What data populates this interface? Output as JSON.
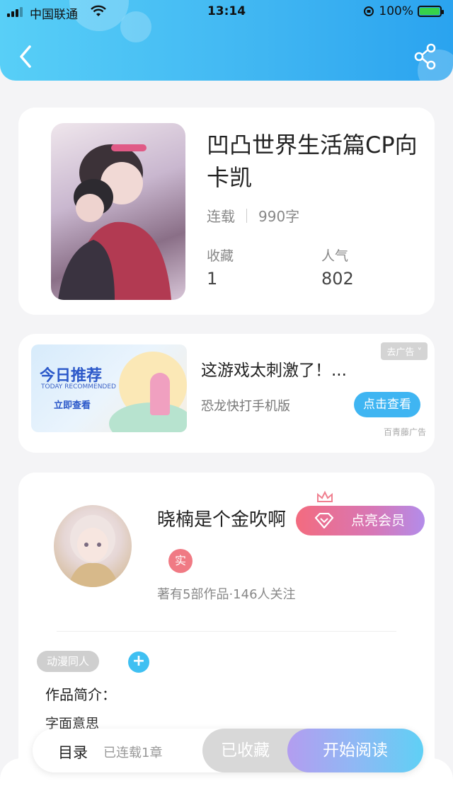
{
  "status_bar": {
    "carrier": "中国联通",
    "time": "13:14",
    "battery": "100%"
  },
  "book": {
    "title": "凹凸世界生活篇CP向卡凯",
    "status": "连载",
    "word_count": "990字",
    "stats": [
      {
        "label": "收藏",
        "value": "1"
      },
      {
        "label": "人气",
        "value": "802"
      }
    ]
  },
  "ad": {
    "tag": "去广告 ˅",
    "image_title": "今日推荐",
    "image_subtitle": "TODAY RECOMMENDED",
    "image_cta": "立即查看",
    "title": "这游戏太刺激了！...",
    "subtitle": "恐龙快打手机版",
    "button": "点击查看",
    "source": "百青藤广告"
  },
  "author": {
    "name": "晓楠是个金吹啊",
    "vip_button": "点亮会员",
    "badge": "实",
    "stats": "著有5部作品·146人关注",
    "tag": "动漫同人",
    "add_tag": "+",
    "intro_label": "作品简介：",
    "intro_text": "字面意思"
  },
  "bottom_bar": {
    "toc": "目录",
    "toc_status": "已连载1章",
    "favorite": "已收藏",
    "read": "开始阅读"
  },
  "colors": {
    "accent": "#3fb5f2",
    "header_start": "#58cff7",
    "vip_start": "#f36b7f",
    "vip_end": "#b38cea"
  }
}
